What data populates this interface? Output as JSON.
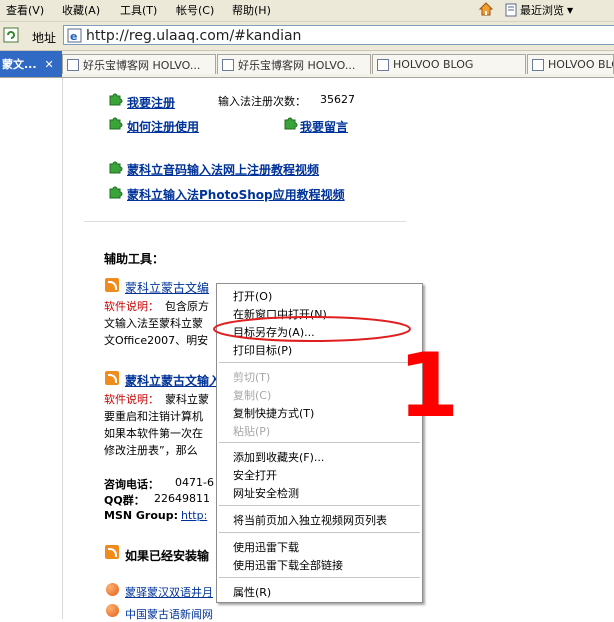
{
  "menubar": {
    "items": [
      "查看(V)",
      "收藏(A)",
      "工具(T)",
      "帐号(C)",
      "帮助(H)"
    ],
    "recent_label": "最近浏览"
  },
  "address": {
    "label": "地址",
    "url": "http://reg.ulaaq.com/#kandian"
  },
  "tabs": {
    "active": "蒙文...",
    "active_close": "✕",
    "items": [
      "好乐宝博客网 HOLVO...",
      "好乐宝博客网 HOLVO...",
      "HOLVOO BLOG",
      "HOLVOO BLO"
    ]
  },
  "page": {
    "register_link": "我要注册",
    "register_count_label": "输入法注册次数：",
    "register_count": "35627",
    "howto_link": "如何注册使用",
    "message_link": "我要留言",
    "video1": "蒙科立音码输入法网上注册教程视频",
    "video2": "蒙科立输入法PhotoShop应用教程视频",
    "tools_heading": "辅助工具：",
    "tool1_link": "蒙科立蒙古文编",
    "tool1_label": "软件说明：",
    "tool1_desc1": "包含原方",
    "tool1_desc2": "文输入法至蒙科立蒙",
    "tool1_desc3": "文Office2007、明安",
    "tool2_link": "蒙科立蒙古文输入",
    "tool2_label": "软件说明：",
    "tool2_desc1": "蒙科立蒙",
    "tool2_desc2": "要重启和注销计算机",
    "tool2_desc3": "如果本软件第一次在",
    "tool2_desc4": "修改注册表”，那么",
    "phone_label": "咨询电话：",
    "phone": "0471-6",
    "qq_label": "QQ群：",
    "qq": "22649811",
    "msn_label": "MSN Group:",
    "msn": "http:",
    "installed_heading": "如果已经安装输",
    "bottom_link1": "蒙驿蒙汉双语井月",
    "bottom_link2": "中国蒙古语新闻网"
  },
  "context_menu": {
    "items": [
      {
        "label": "打开(O)",
        "disabled": false
      },
      {
        "label": "在新窗口中打开(N)",
        "disabled": false
      },
      {
        "label": "目标另存为(A)...",
        "disabled": false
      },
      {
        "label": "打印目标(P)",
        "disabled": false
      },
      {
        "label": "剪切(T)",
        "disabled": true
      },
      {
        "label": "复制(C)",
        "disabled": true
      },
      {
        "label": "复制快捷方式(T)",
        "disabled": false
      },
      {
        "label": "粘贴(P)",
        "disabled": true
      },
      {
        "label": "添加到收藏夹(F)...",
        "disabled": false
      },
      {
        "label": "安全打开",
        "disabled": false
      },
      {
        "label": "网址安全检测",
        "disabled": false
      },
      {
        "label": "将当前页加入独立视频网页列表",
        "disabled": false
      },
      {
        "label": "使用迅雷下载",
        "disabled": false
      },
      {
        "label": "使用迅雷下载全部链接",
        "disabled": false
      },
      {
        "label": "属性(R)",
        "disabled": false
      }
    ]
  },
  "annotation": {
    "number": "1",
    "color": "#ff0000"
  },
  "colors": {
    "link": "#003399",
    "label_red": "#cc0000",
    "chrome": "#ece9d8",
    "active_tab": "#316ac5"
  }
}
